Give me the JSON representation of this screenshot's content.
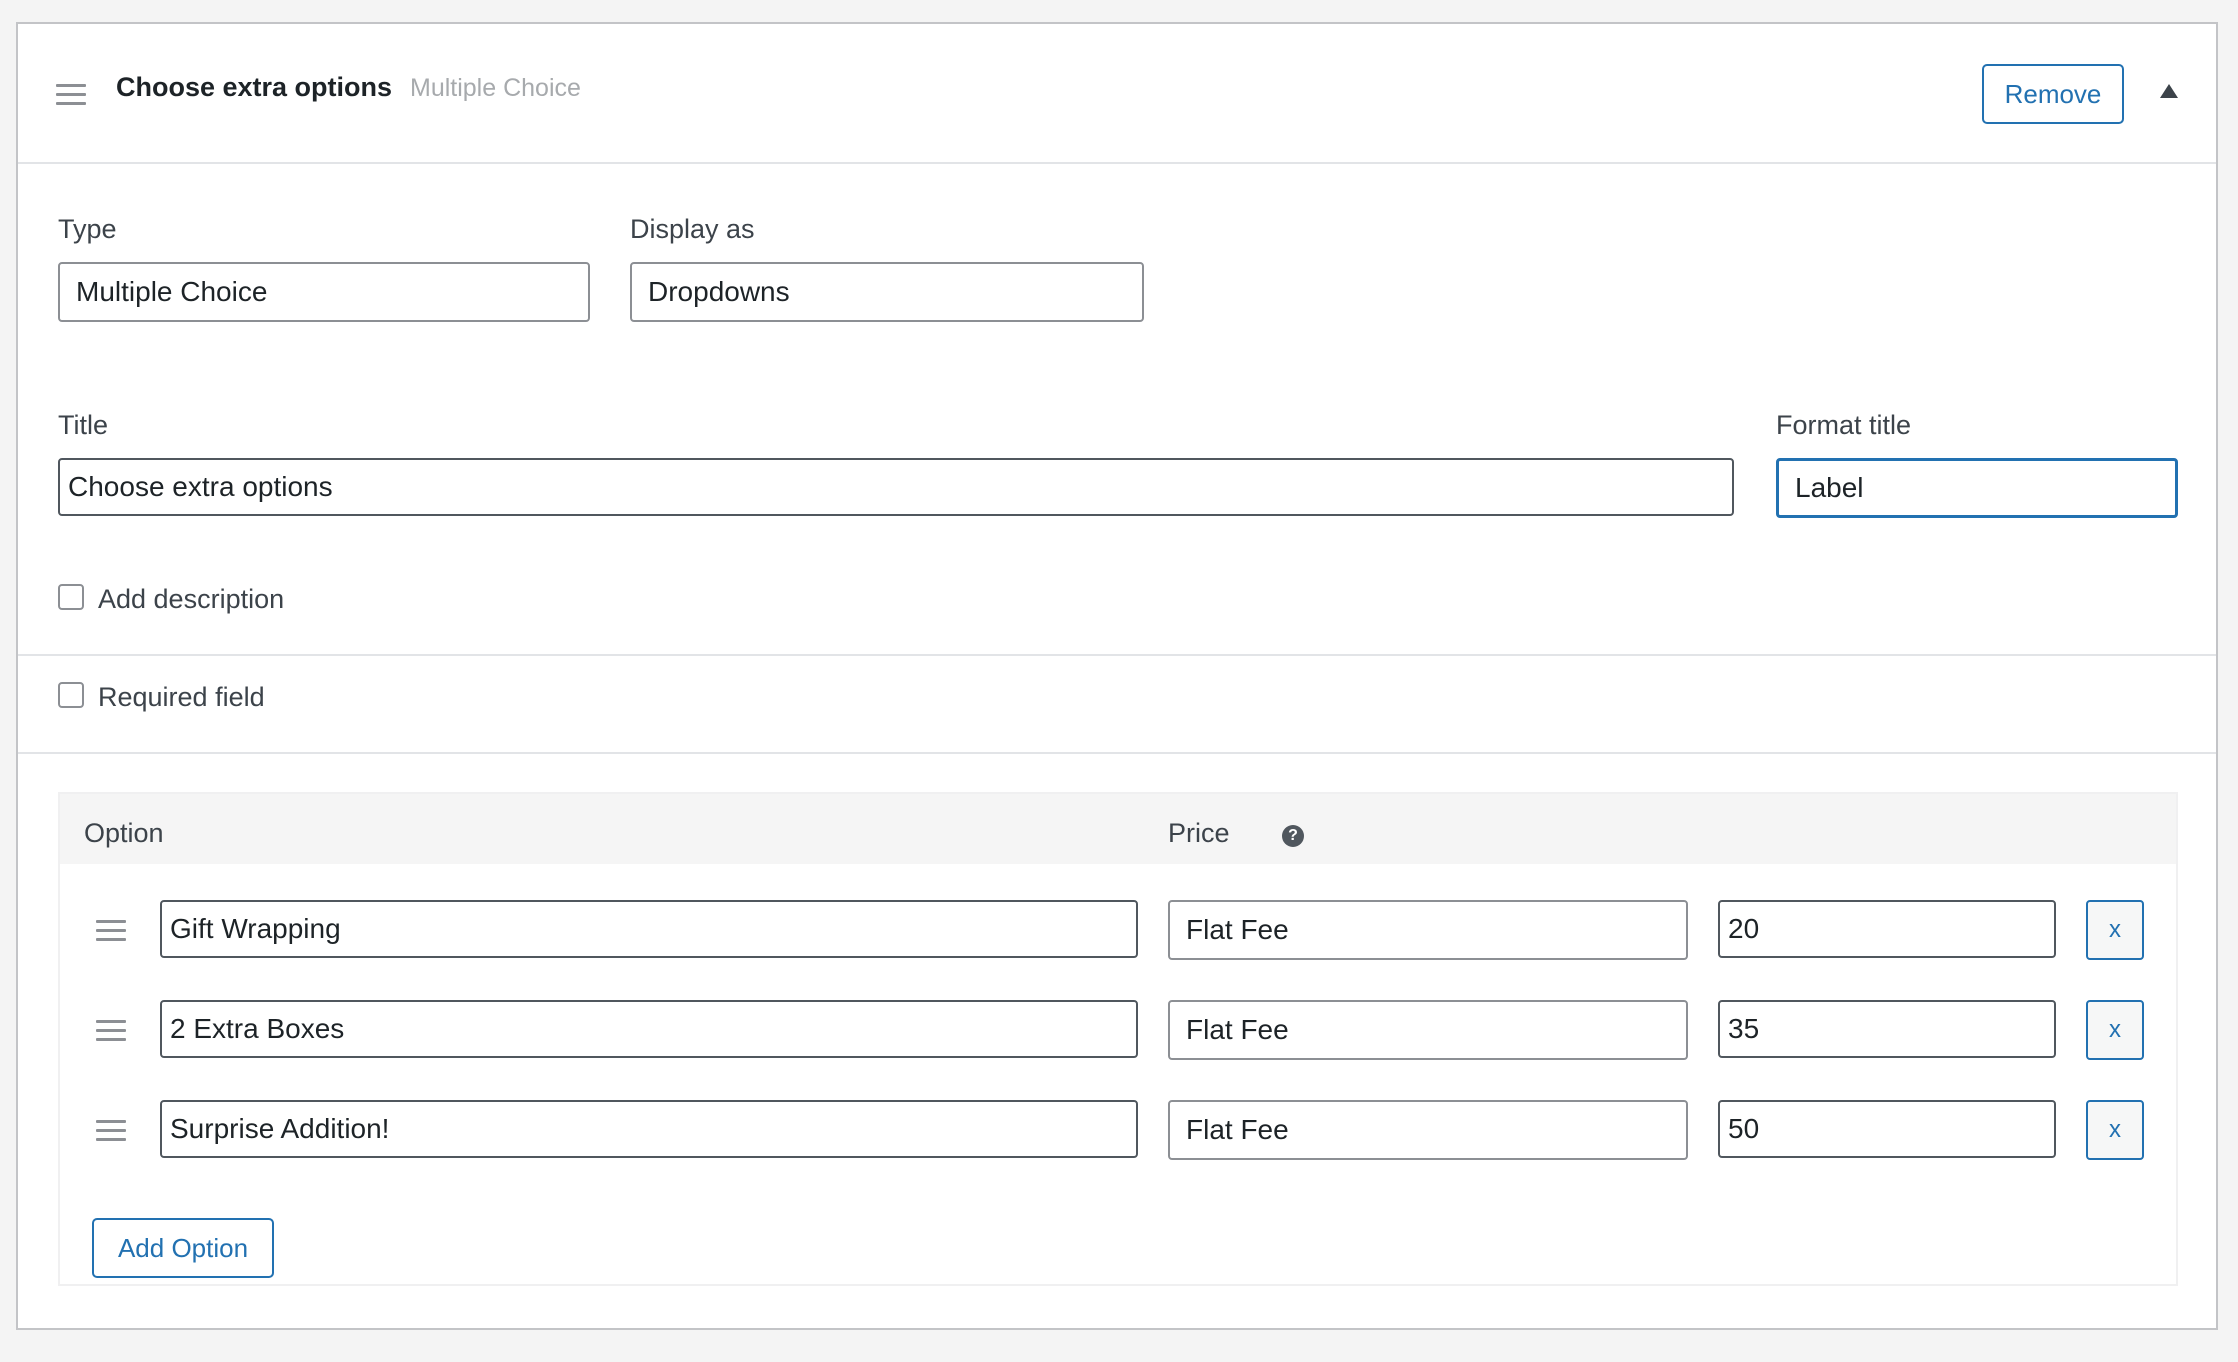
{
  "header": {
    "title": "Choose extra options",
    "subtitle": "Multiple Choice",
    "remove_label": "Remove"
  },
  "type": {
    "label": "Type",
    "value": "Multiple Choice"
  },
  "display_as": {
    "label": "Display as",
    "value": "Dropdowns"
  },
  "title_field": {
    "label": "Title",
    "value": "Choose extra options"
  },
  "format_title": {
    "label": "Format title",
    "value": "Label"
  },
  "add_description": {
    "label": "Add description",
    "checked": false
  },
  "required_field": {
    "label": "Required field",
    "checked": false
  },
  "options_table": {
    "col_option": "Option",
    "col_price": "Price",
    "help_glyph": "?",
    "remove_glyph": "x",
    "rows": [
      {
        "option": "Gift Wrapping",
        "price_type": "Flat Fee",
        "price": "20"
      },
      {
        "option": "2 Extra Boxes",
        "price_type": "Flat Fee",
        "price": "35"
      },
      {
        "option": "Surprise Addition!",
        "price_type": "Flat Fee",
        "price": "50"
      }
    ],
    "add_option_label": "Add Option"
  },
  "icons": {
    "drag": "hamburger-drag-icon",
    "collapse": "caret-up-icon",
    "help": "question-circle-icon"
  },
  "colors": {
    "accent": "#2271b1",
    "border": "#8c8f94",
    "muted": "#a7aaad"
  }
}
